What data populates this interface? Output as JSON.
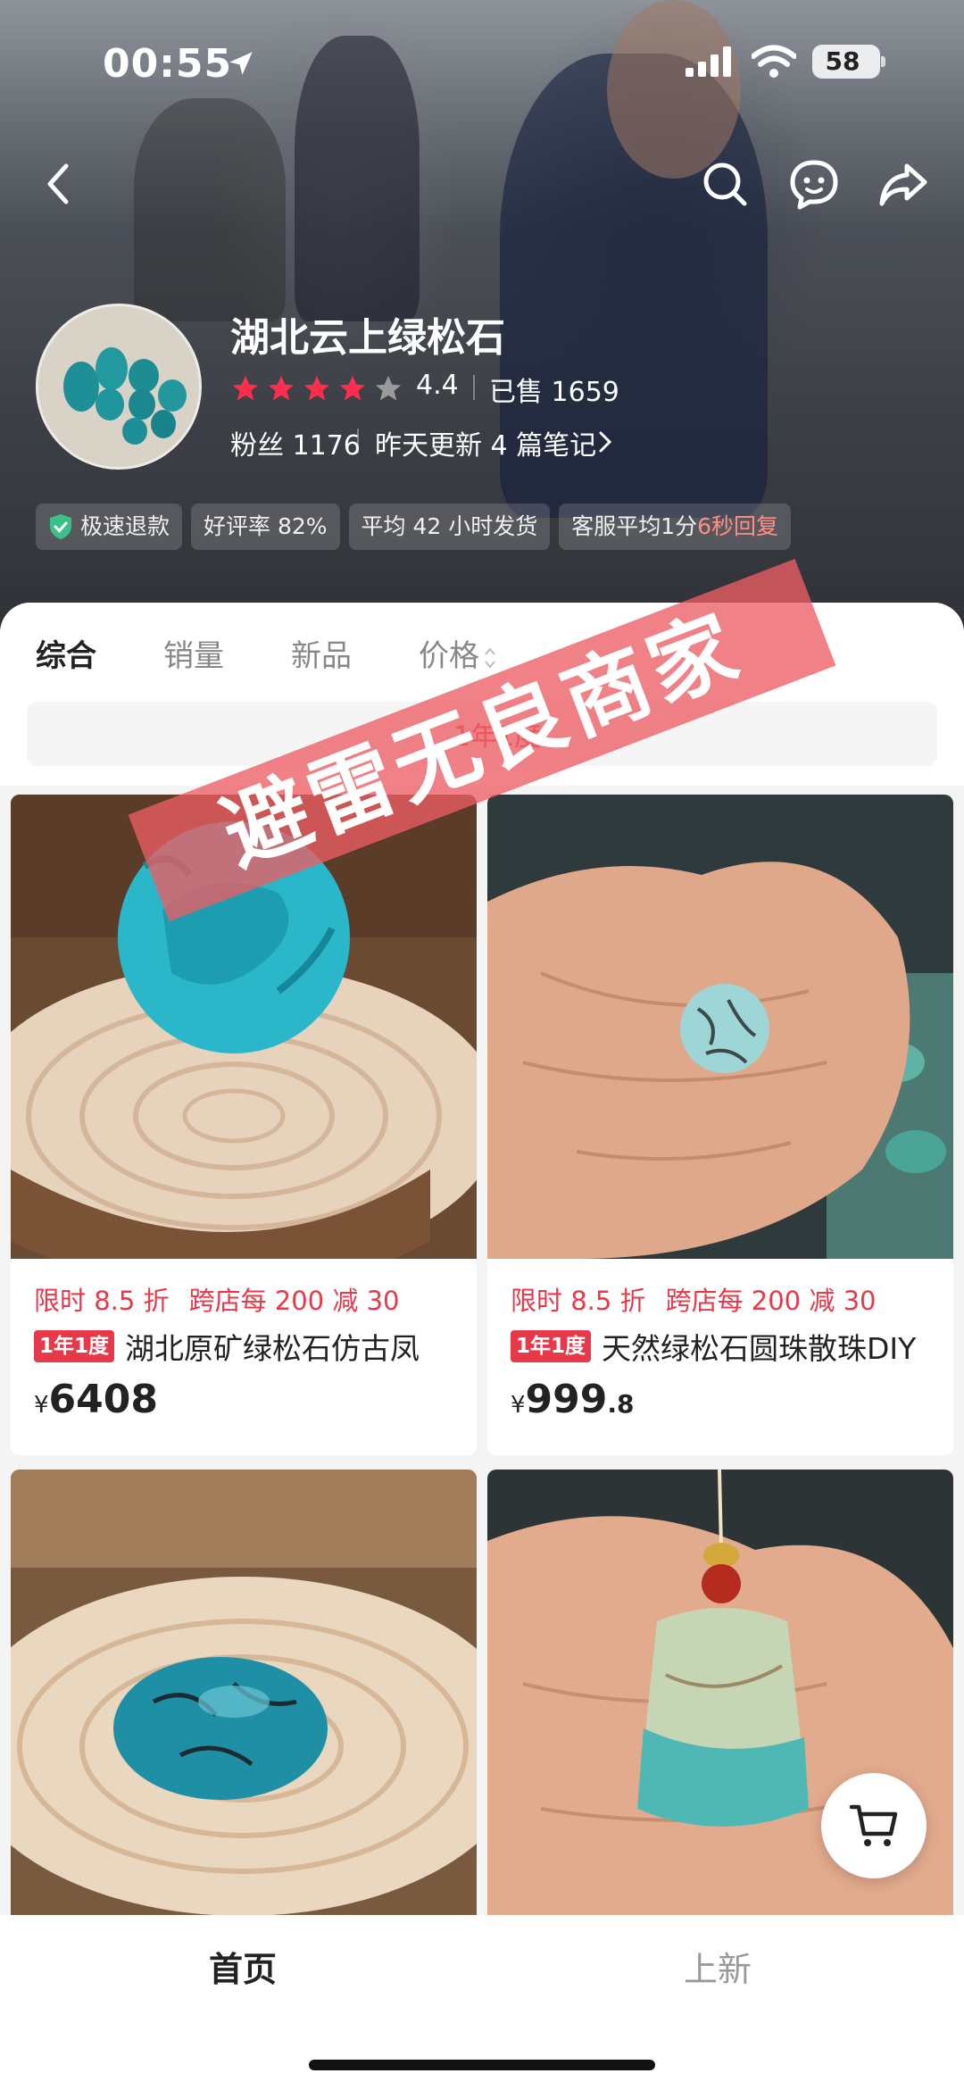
{
  "status_bar": {
    "time": "00:55",
    "battery": "58"
  },
  "store": {
    "name": "湖北云上绿松石",
    "rating": "4.4",
    "sold": "已售 1659",
    "fans": "粉丝 1176",
    "updated": "昨天更新 4 篇笔记"
  },
  "tags": [
    {
      "label": "极速退款"
    },
    {
      "label": "好评率 82%"
    },
    {
      "label": "平均 42 小时发货"
    },
    {
      "label_main": "客服平均1分",
      "label_highlight": "6秒回复"
    }
  ],
  "tabs": [
    "综合",
    "销量",
    "新品",
    "价格"
  ],
  "notice": "1年1度",
  "banner": "避雷无良商家",
  "products": [
    {
      "promo1": "限时 8.5 折",
      "promo2": "跨店每 200 减 30",
      "badge": "1年1度",
      "title": "湖北原矿绿松石仿古凤",
      "price_yen": "¥",
      "price_int": "6408",
      "price_dec": ""
    },
    {
      "promo1": "限时 8.5 折",
      "promo2": "跨店每 200 减 30",
      "badge": "1年1度",
      "title": "天然绿松石圆珠散珠DIY",
      "price_yen": "¥",
      "price_int": "999",
      "price_dec": ".8"
    }
  ],
  "bottom_nav": {
    "home": "首页",
    "new": "上新"
  },
  "colors": {
    "accent": "#e8394a",
    "star": "#ff2e4d",
    "turquoise": "#2ab7c9"
  }
}
